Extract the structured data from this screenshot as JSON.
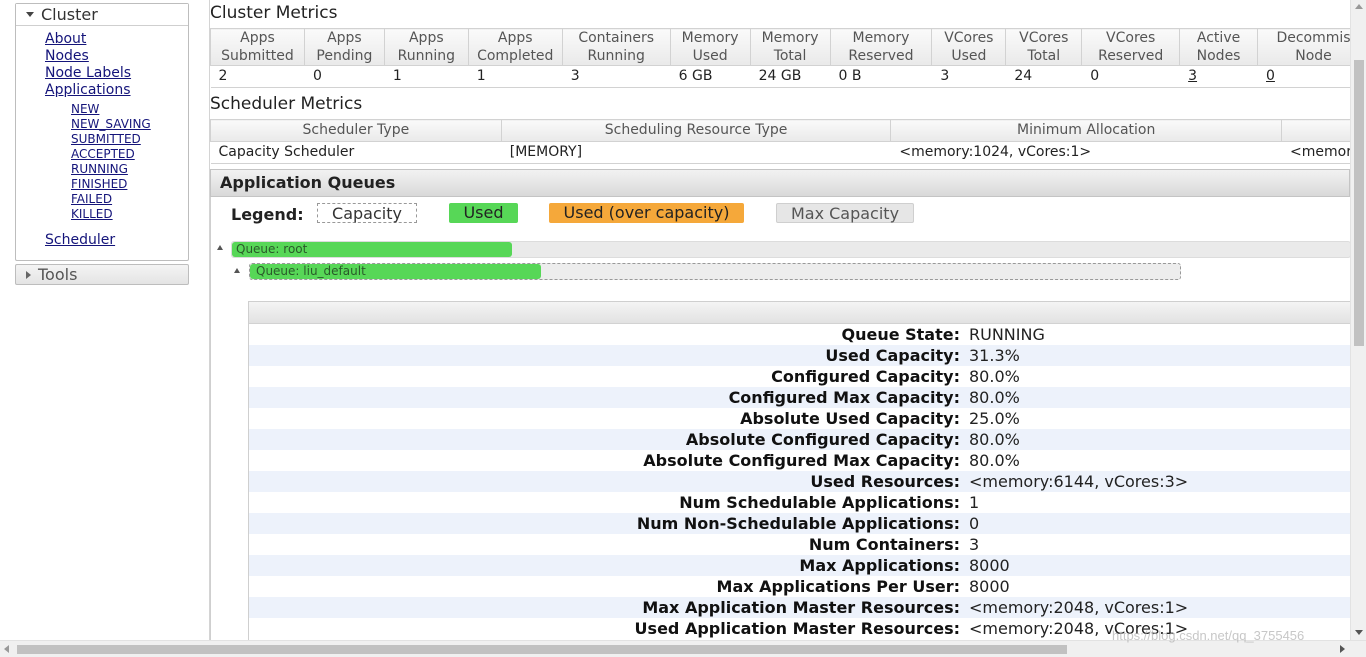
{
  "nav": {
    "cluster": {
      "title": "Cluster",
      "links": [
        "About",
        "Nodes",
        "Node Labels",
        "Applications"
      ],
      "app_states": [
        "NEW",
        "NEW_SAVING",
        "SUBMITTED",
        "ACCEPTED",
        "RUNNING",
        "FINISHED",
        "FAILED",
        "KILLED"
      ],
      "scheduler": "Scheduler"
    },
    "tools": {
      "title": "Tools"
    }
  },
  "cluster_metrics": {
    "title": "Cluster Metrics",
    "headers": [
      [
        "Apps",
        "Submitted"
      ],
      [
        "Apps",
        "Pending"
      ],
      [
        "Apps",
        "Running"
      ],
      [
        "Apps",
        "Completed"
      ],
      [
        "Containers",
        "Running"
      ],
      [
        "Memory",
        "Used"
      ],
      [
        "Memory",
        "Total"
      ],
      [
        "Memory",
        "Reserved"
      ],
      [
        "VCores",
        "Used"
      ],
      [
        "VCores",
        "Total"
      ],
      [
        "VCores",
        "Reserved"
      ],
      [
        "Active",
        "Nodes"
      ],
      [
        "Decommis",
        "Node"
      ]
    ],
    "values": [
      "2",
      "0",
      "1",
      "1",
      "3",
      "6 GB",
      "24 GB",
      "0 B",
      "3",
      "24",
      "0",
      "3",
      "0"
    ]
  },
  "scheduler_metrics": {
    "title": "Scheduler Metrics",
    "headers": [
      "Scheduler Type",
      "Scheduling Resource Type",
      "Minimum Allocation",
      ""
    ],
    "values": [
      "Capacity Scheduler",
      "[MEMORY]",
      "<memory:1024, vCores:1>",
      "<memor"
    ]
  },
  "app_queues": {
    "title": "Application Queues",
    "legend": {
      "label": "Legend:",
      "capacity": "Capacity",
      "used": "Used",
      "over": "Used (over capacity)",
      "max": "Max Capacity"
    },
    "colors": {
      "used": "#57d757",
      "over": "#f5a83a",
      "max": "#e6e6e6"
    },
    "queues": [
      {
        "name": "Queue: root",
        "used_fraction": 0.25
      },
      {
        "name": "Queue: liu_default",
        "used_fraction": 0.313
      }
    ],
    "details": [
      {
        "k": "Queue State:",
        "v": "RUNNING"
      },
      {
        "k": "Used Capacity:",
        "v": "31.3%"
      },
      {
        "k": "Configured Capacity:",
        "v": "80.0%"
      },
      {
        "k": "Configured Max Capacity:",
        "v": "80.0%"
      },
      {
        "k": "Absolute Used Capacity:",
        "v": "25.0%"
      },
      {
        "k": "Absolute Configured Capacity:",
        "v": "80.0%"
      },
      {
        "k": "Absolute Configured Max Capacity:",
        "v": "80.0%"
      },
      {
        "k": "Used Resources:",
        "v": "<memory:6144, vCores:3>"
      },
      {
        "k": "Num Schedulable Applications:",
        "v": "1"
      },
      {
        "k": "Num Non-Schedulable Applications:",
        "v": "0"
      },
      {
        "k": "Num Containers:",
        "v": "3"
      },
      {
        "k": "Max Applications:",
        "v": "8000"
      },
      {
        "k": "Max Applications Per User:",
        "v": "8000"
      },
      {
        "k": "Max Application Master Resources:",
        "v": "<memory:2048, vCores:1>"
      },
      {
        "k": "Used Application Master Resources:",
        "v": "<memory:2048, vCores:1>"
      }
    ]
  },
  "watermark": "https://blog.csdn.net/qq_3755456"
}
